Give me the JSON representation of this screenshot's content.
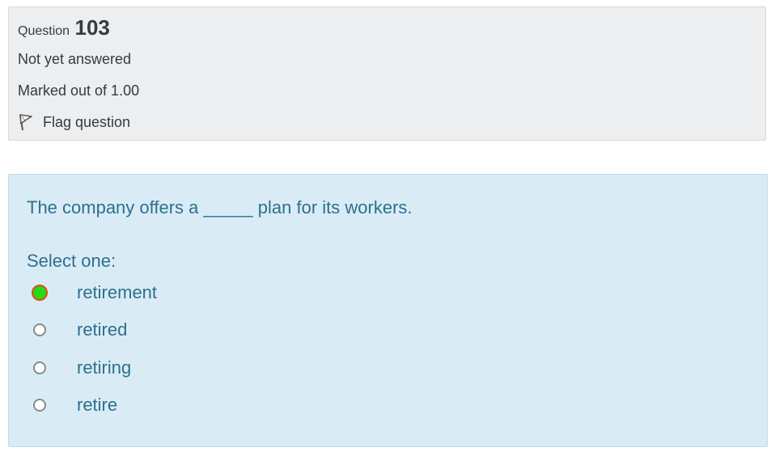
{
  "info": {
    "question_label": "Question",
    "question_number": "103",
    "state": "Not yet answered",
    "grade": "Marked out of 1.00",
    "flag_label": "Flag question",
    "flag_icon": "flag-icon"
  },
  "question": {
    "text": "The company offers a _____ plan for its workers.",
    "prompt": "Select one:",
    "options": [
      {
        "label": "retirement",
        "selected": true
      },
      {
        "label": "retired",
        "selected": false
      },
      {
        "label": "retiring",
        "selected": false
      },
      {
        "label": "retire",
        "selected": false
      }
    ]
  },
  "colors": {
    "info_bg": "#eceeef",
    "content_bg": "#d9ecf5",
    "content_text": "#2f6f8f",
    "selected_fill": "#22dd11",
    "selected_border": "#e24b1d"
  }
}
